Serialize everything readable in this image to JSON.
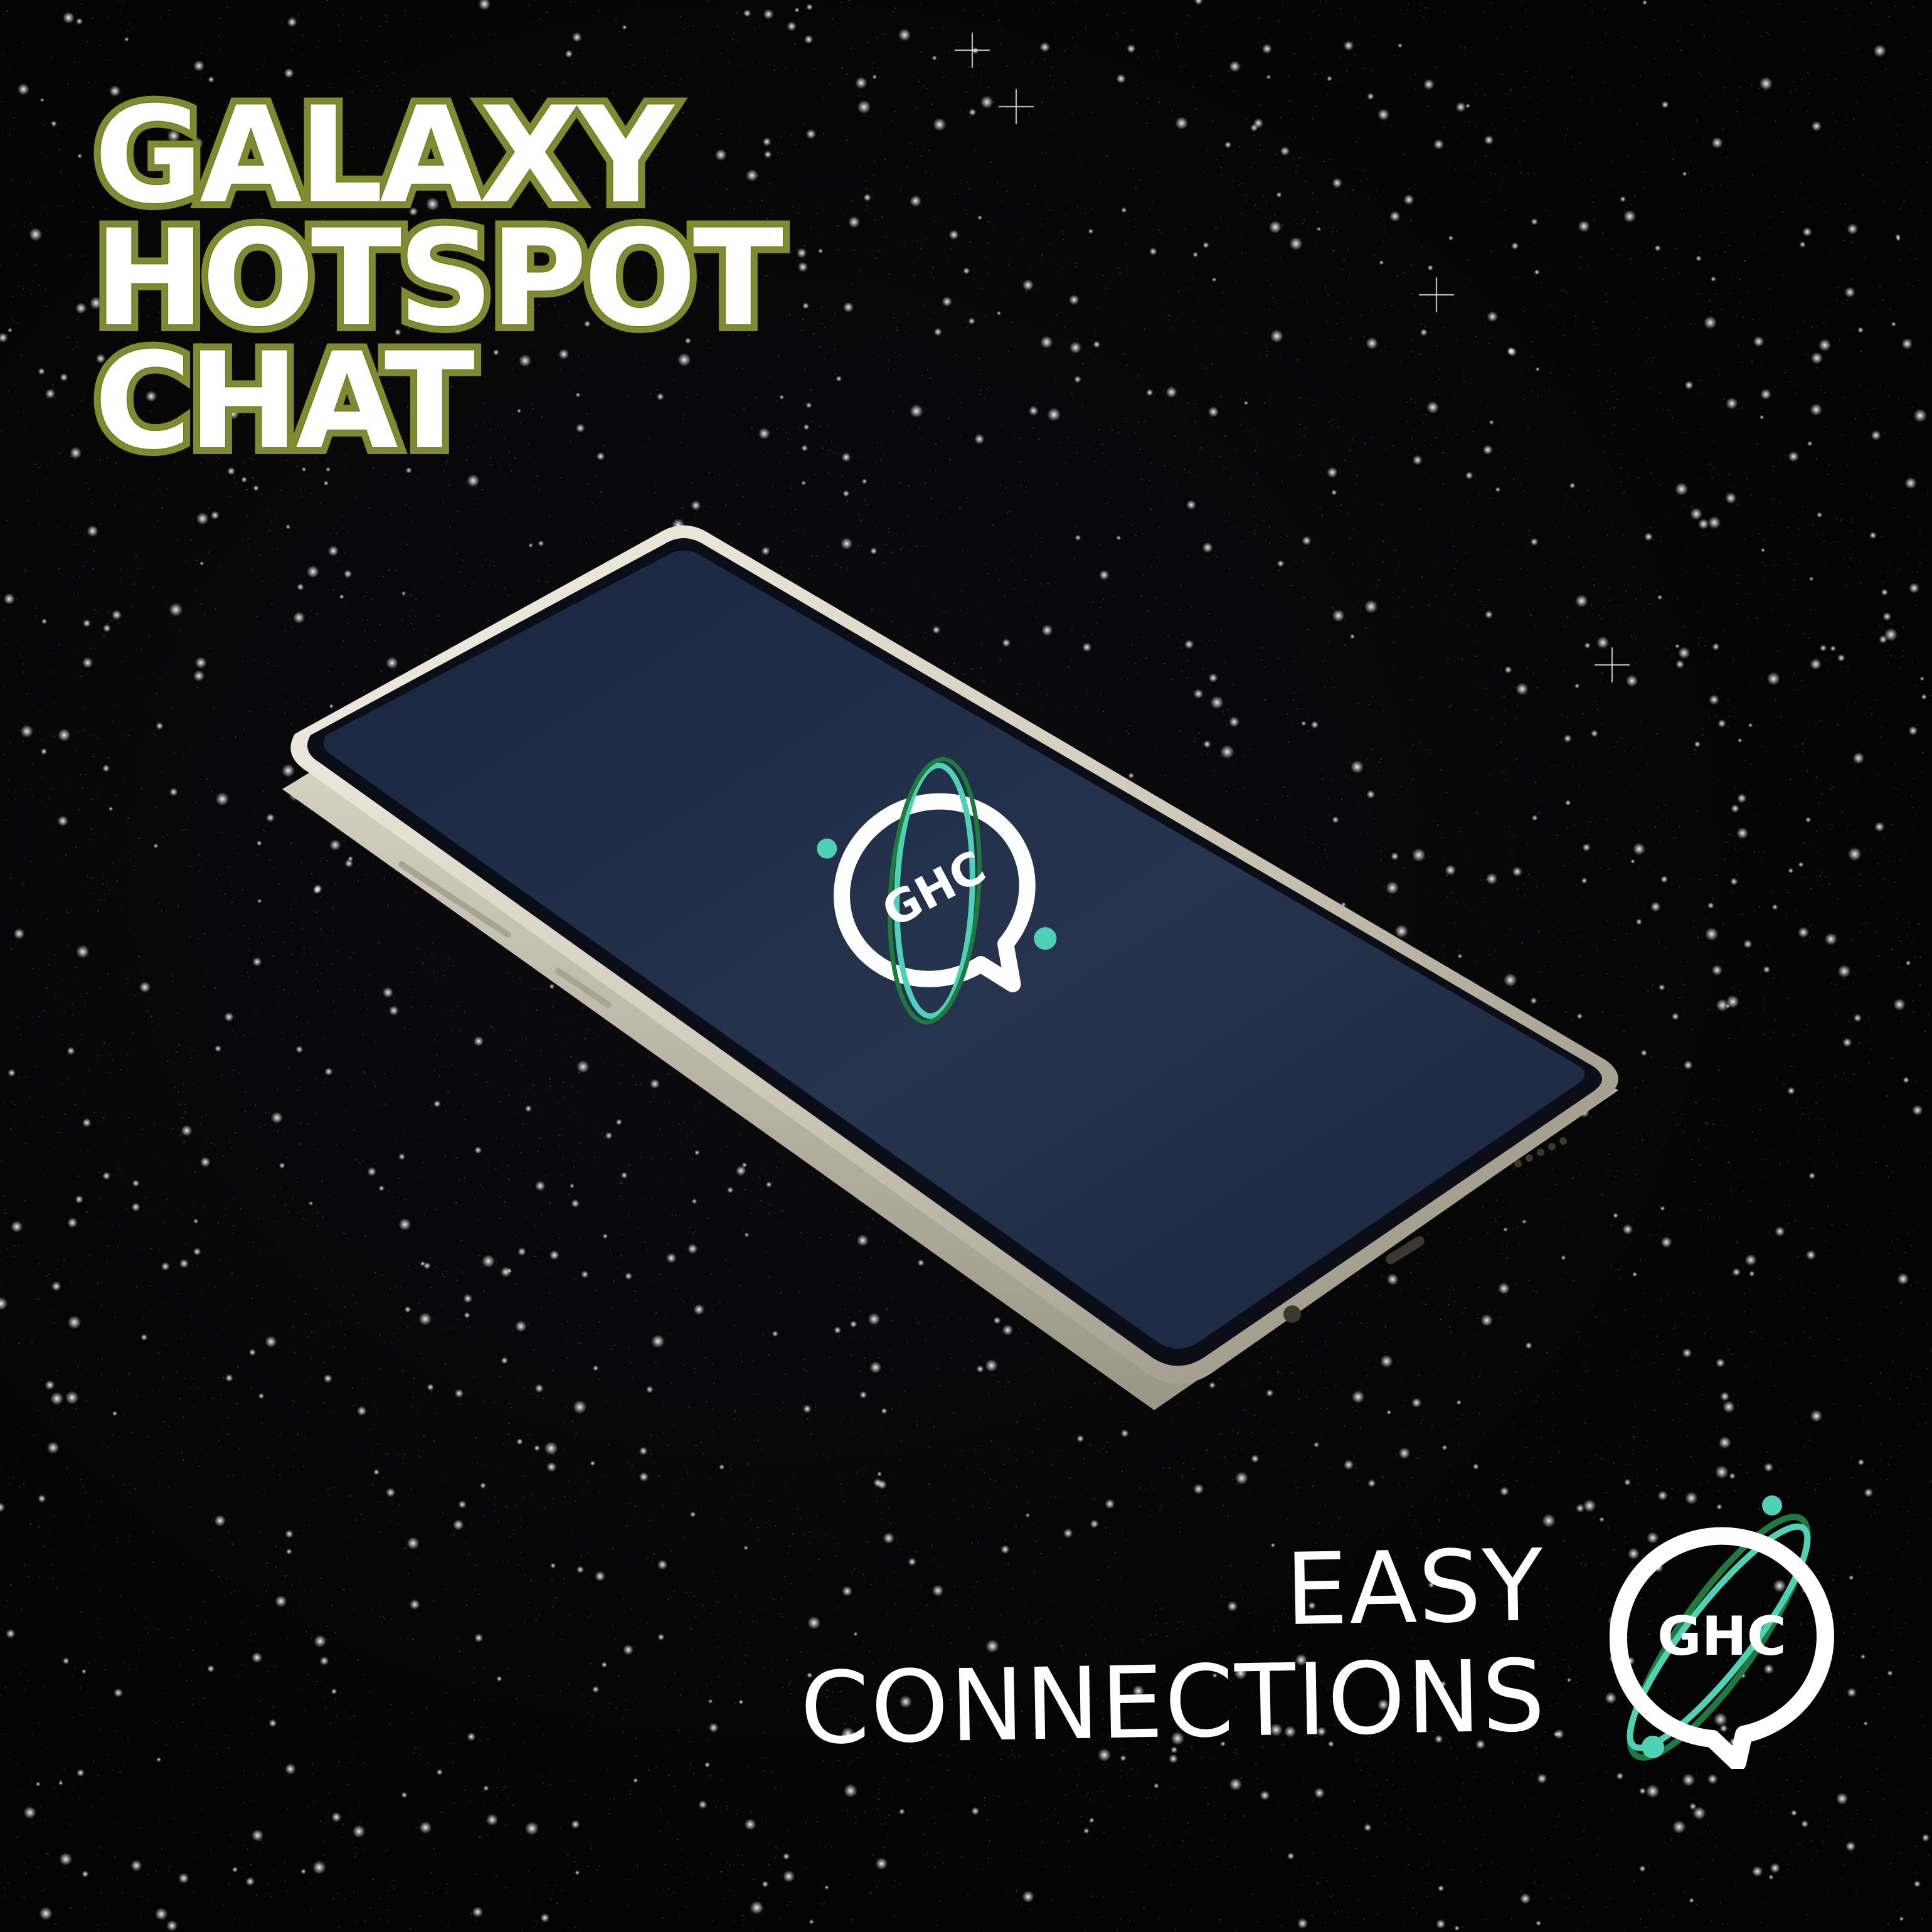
{
  "headline": {
    "line1": "GALAXY",
    "line2": "HOTSPOT",
    "line3": "CHAT"
  },
  "tagline": {
    "line1": "EASY",
    "line2": "CONNECTIONS"
  },
  "logo": {
    "text": "GHC",
    "name": "ghc-logo-icon"
  },
  "phone_screen_logo": {
    "text": "GHC"
  },
  "colors": {
    "background": "#050505",
    "headline_fill": "#ffffff",
    "headline_outline": "#7f8b2e",
    "screen": "#1f2c45",
    "phone_frame": "#d9d6c8",
    "logo_teal": "#4fd1b5",
    "logo_green": "#1f7a3e"
  }
}
